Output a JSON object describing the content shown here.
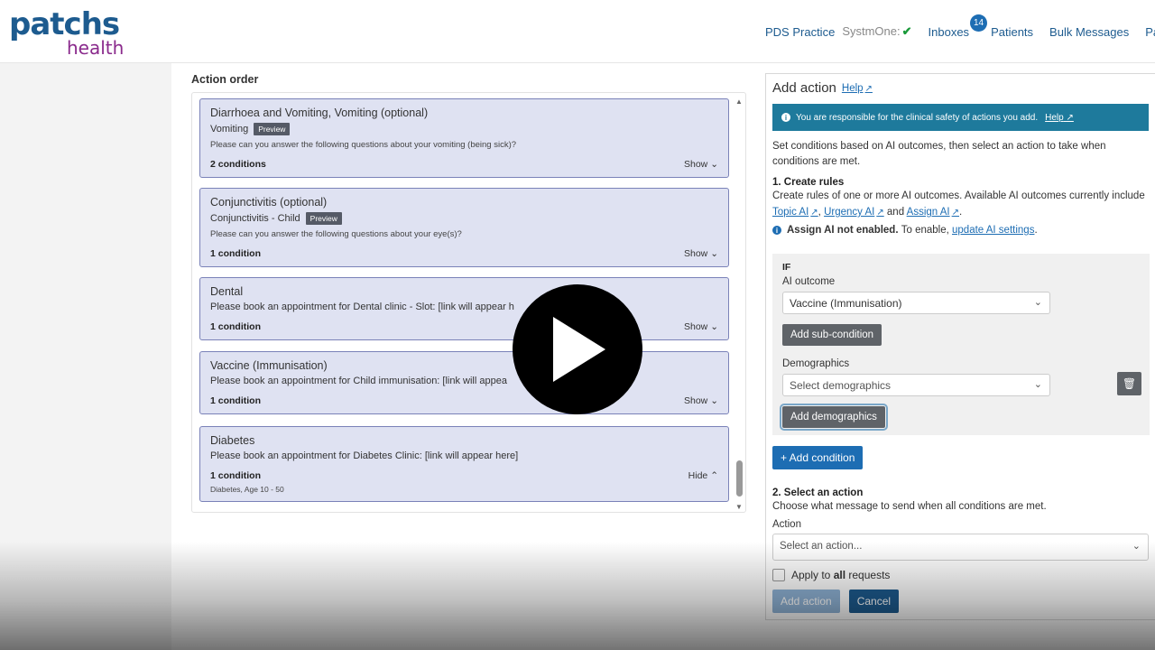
{
  "header": {
    "logo_top": "patchs",
    "logo_bottom": "health",
    "nav": {
      "practice": "PDS Practice",
      "system": "SystmOne:",
      "inboxes": "Inboxes",
      "inbox_count": "14",
      "patients": "Patients",
      "bulk": "Bulk Messages",
      "cut": "Pa"
    }
  },
  "action_order": {
    "title": "Action order",
    "cards": [
      {
        "title": "Diarrhoea and Vomiting, Vomiting (optional)",
        "sub": "Vomiting",
        "tag": "Preview",
        "question": "Please can you answer the following questions about your vomiting (being sick)?",
        "conditions": "2 conditions",
        "toggle": "Show"
      },
      {
        "title": "Conjunctivitis (optional)",
        "sub": "Conjunctivitis - Child",
        "tag": "Preview",
        "question": "Please can you answer the following questions about your eye(s)?",
        "conditions": "1 condition",
        "toggle": "Show"
      },
      {
        "title": "Dental",
        "sub": "Please book an appointment for Dental clinic - Slot: [link will appear h",
        "conditions": "1 condition",
        "toggle": "Show"
      },
      {
        "title": "Vaccine (Immunisation)",
        "sub": "Please book an appointment for Child immunisation: [link will appea",
        "conditions": "1 condition",
        "toggle": "Show"
      },
      {
        "title": "Diabetes",
        "sub": "Please book an appointment for Diabetes Clinic: [link will appear here]",
        "conditions": "1 condition",
        "toggle": "Hide",
        "meta": "Diabetes, Age 10 - 50"
      }
    ]
  },
  "panel": {
    "title": "Add action",
    "help": "Help",
    "info": "You are responsible for the clinical safety of actions you add.",
    "info_help": "Help",
    "intro": "Set conditions based on AI outcomes, then select an action to take when conditions are met.",
    "step1_title": "1. Create rules",
    "step1_text": "Create rules of one or more AI outcomes. Available AI outcomes currently include",
    "topic_ai": "Topic AI",
    "urgency_ai": "Urgency AI",
    "and": "and",
    "assign_ai": "Assign AI",
    "assign_note_bold": "Assign AI not enabled.",
    "assign_note_text": "To enable,",
    "assign_note_link": "update AI settings",
    "if_label": "IF",
    "ai_outcome_label": "AI outcome",
    "ai_outcome_value": "Vaccine (Immunisation)",
    "add_sub_condition": "Add sub-condition",
    "demographics_label": "Demographics",
    "demographics_placeholder": "Select demographics",
    "add_demographics": "Add demographics",
    "add_condition": "+ Add condition",
    "step2_title": "2. Select an action",
    "step2_text": "Choose what message to send when all conditions are met.",
    "action_label": "Action",
    "action_placeholder": "Select an action...",
    "apply_prefix": "Apply to",
    "apply_bold": "all",
    "apply_suffix": "requests",
    "add_action_btn": "Add action",
    "cancel_btn": "Cancel"
  },
  "colors": {
    "brand_blue": "#1d5b8f",
    "brand_magenta": "#8a2a8c",
    "card_bg": "#dfe2f2",
    "info_bar": "#1e7a9c"
  }
}
